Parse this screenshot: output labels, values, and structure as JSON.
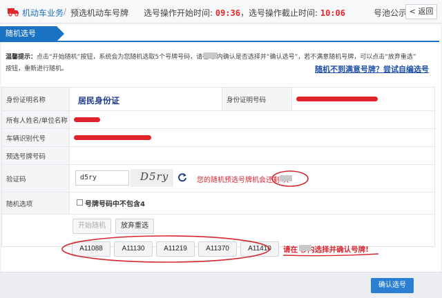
{
  "header": {
    "breadcrumb_main": "机动车业务",
    "breadcrumb_sep": "/",
    "breadcrumb_sub": "预选机动车号牌",
    "start_label": "选号操作开始时间: ",
    "start_time": "09:36",
    "end_label": "，选号操作截止时间: ",
    "end_time": "10:06",
    "pool_notice": "号池公示",
    "back_label": "返回"
  },
  "tab": {
    "label": "随机选号"
  },
  "hint": {
    "line1_prefix": "温馨提示：",
    "line1": "点击“开始随机”按钮，系统会为您随机选取5个号牌号码，请在     秒内确认是否选择并“确认选号”，若不满意随机号牌，可以点击“放弃重选”",
    "line2": "按钮，重新进行随机。",
    "self_link": "随机不到满意号牌？尝试自编选号"
  },
  "form": {
    "id_type_label": "身份证明名称",
    "id_type_value": "居民身份证",
    "id_number_label": "身份证明号码",
    "owner_label": "所有人姓名/单位名称",
    "vin_label": "车辆识别代号",
    "preselect_label": "预选号牌号码",
    "captcha_label": "验证码",
    "captcha_value": "d5ry",
    "captcha_image_text": "D5ry",
    "remain_text": "您的随机预选号牌机会还剩   次",
    "random_option_label": "随机选项",
    "exclude4_label": "号牌号码中不包含4",
    "start_random": "开始随机",
    "give_up": "放弃重选"
  },
  "plates": [
    "A11088",
    "A11130",
    "A11219",
    "A11370",
    "A11410"
  ],
  "confirm_hint": "请在     秒内选择并确认号牌!",
  "confirm_button": "确认选号",
  "colors": {
    "brand_blue": "#1a73c2",
    "time_red": "#e3262a",
    "annotation_red": "#d6262d"
  }
}
